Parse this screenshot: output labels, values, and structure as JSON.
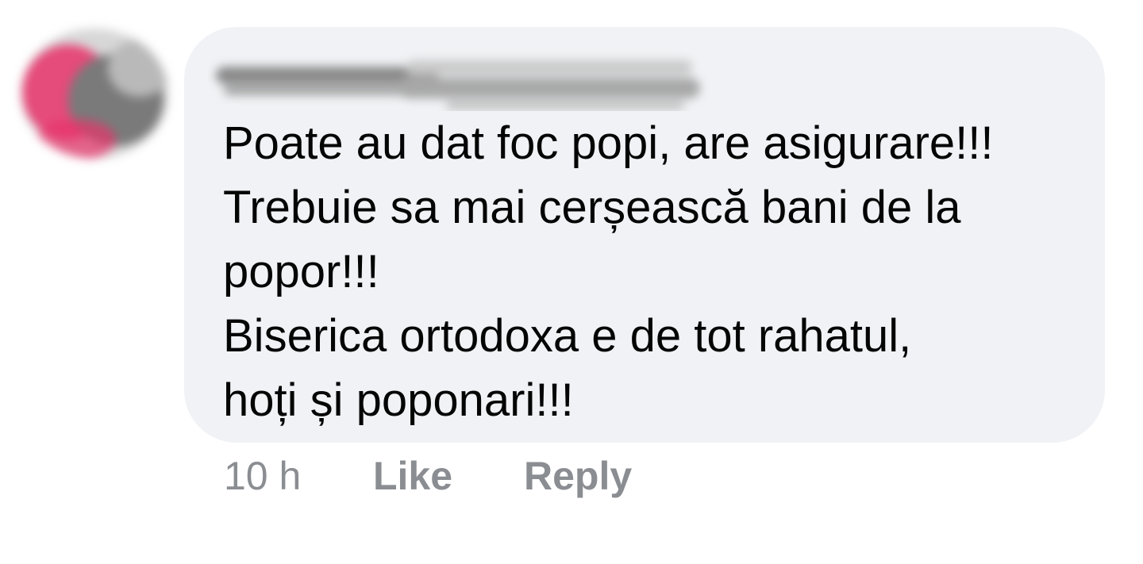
{
  "comment": {
    "author_name": "",
    "text_lines": [
      "Poate au dat foc popi, are asigurare!!!",
      "Trebuie sa mai cerșească bani de la",
      "popor!!!",
      "Biserica ortodoxa e de tot rahatul,",
      "hoți și poponari!!!"
    ],
    "timestamp": "10 h",
    "like_label": "Like",
    "reply_label": "Reply"
  },
  "colors": {
    "bubble_background": "#f0f2f5",
    "text": "#050505",
    "meta_text": "#8a8d91",
    "avatar_accent": "#e8336b"
  },
  "icons": {
    "avatar": "blurred-profile-picture",
    "author_name": "blurred-name-redaction"
  }
}
